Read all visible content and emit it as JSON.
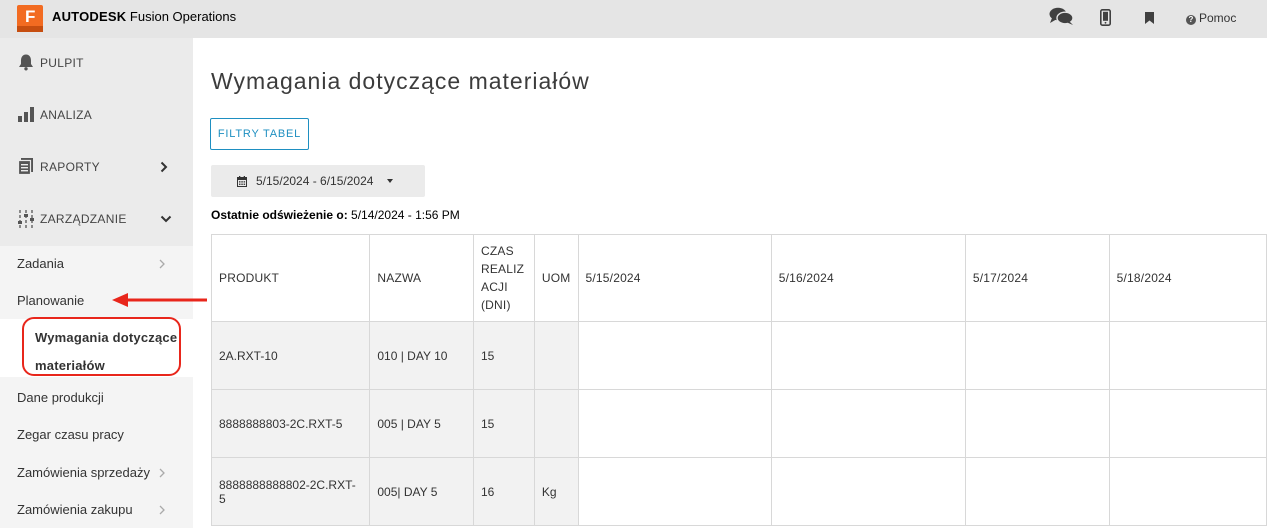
{
  "app": {
    "logo_letter": "F",
    "brand_bold": "AUTODESK",
    "brand_rest": " Fusion Operations",
    "accent_color": "#f26b21"
  },
  "topbar": {
    "icons": [
      "chat-icon",
      "mobile-icon",
      "bookmark-icon",
      "help-icon"
    ],
    "help_label": "Pomoc"
  },
  "sidebar": {
    "main": [
      {
        "label": "PULPIT",
        "icon": "bell-icon"
      },
      {
        "label": "ANALIZA",
        "icon": "bar-chart-icon"
      },
      {
        "label": "RAPORTY",
        "icon": "report-icon"
      },
      {
        "label": "ZARZĄDZANIE",
        "icon": "sliders-icon"
      }
    ],
    "sub": [
      {
        "label": "Zadania"
      },
      {
        "label": "Planowanie"
      },
      {
        "label": "Wymagania dotyczące materiałów",
        "active": true
      },
      {
        "label": "Dane produkcji"
      },
      {
        "label": "Zegar czasu pracy"
      },
      {
        "label": "Zamówienia sprzedaży"
      },
      {
        "label": "Zamówienia zakupu"
      }
    ]
  },
  "main": {
    "title": "Wymagania dotyczące materiałów",
    "filter_button": "FILTRY TABEL",
    "date_range": "5/15/2024 - 6/15/2024",
    "refresh_label": "Ostatnie odświeżenie o:",
    "refresh_value": " 5/14/2024 - 1:56 PM"
  },
  "table": {
    "headers": [
      "PRODUKT",
      "NAZWA",
      "CZAS REALIZ ACJI (DNI)",
      "UOM",
      "5/15/2024",
      "5/16/2024",
      "5/17/2024",
      "5/18/2024"
    ],
    "header_lead_time_lines": [
      "CZAS",
      "REALIZ",
      "ACJI",
      "(DNI)"
    ],
    "rows": [
      {
        "produkt": "2A.RXT-10",
        "nazwa": "010 | DAY 10",
        "czas": "15",
        "uom": ""
      },
      {
        "produkt": "8888888803-2C.RXT-5",
        "nazwa": "005 | DAY 5",
        "czas": "15",
        "uom": ""
      },
      {
        "produkt": "8888888888802-2C.RXT-5",
        "nazwa": "005| DAY 5",
        "czas": "16",
        "uom": "Kg"
      }
    ]
  },
  "annotation": {
    "color": "#e8261b"
  }
}
